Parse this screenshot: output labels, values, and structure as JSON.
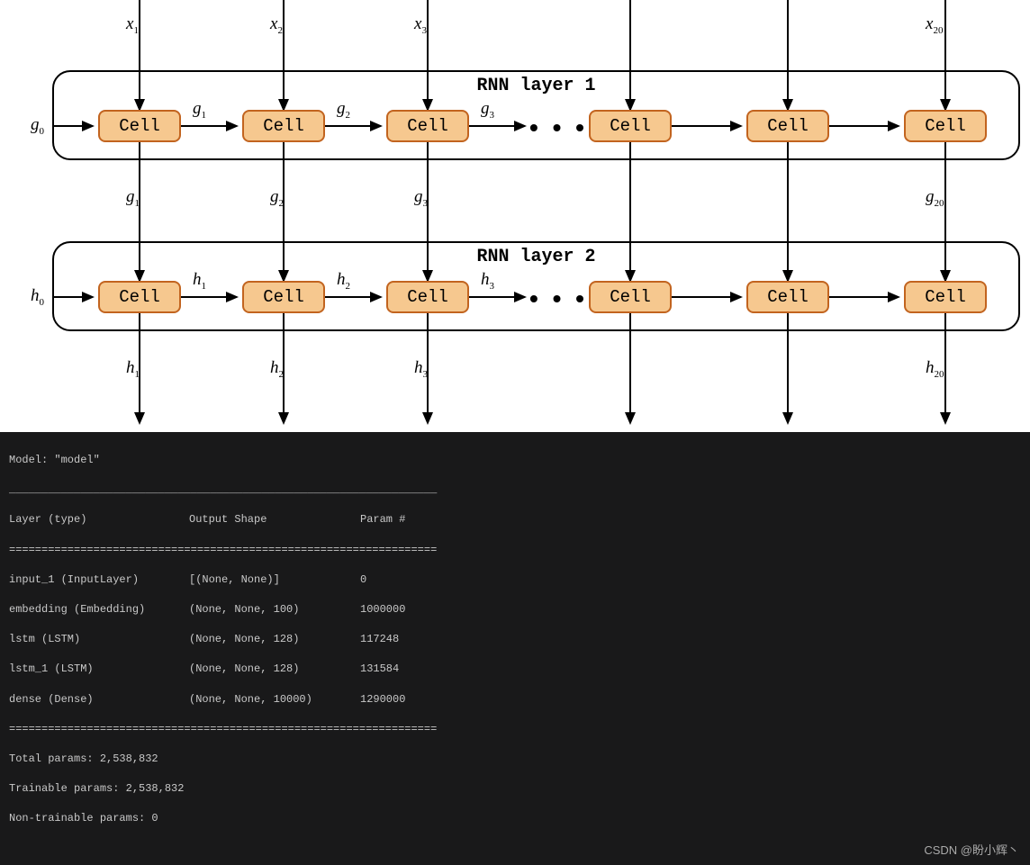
{
  "diagram": {
    "layer1": {
      "title": "RNN layer 1"
    },
    "layer2": {
      "title": "RNN layer 2"
    },
    "cell_label": "Cell",
    "inputs": {
      "x1": "x",
      "x1s": "1",
      "x2": "x",
      "x2s": "2",
      "x3": "x",
      "x3s": "3",
      "x20": "x",
      "x20s": "20"
    },
    "g_init": "g",
    "g_init_s": "0",
    "g": {
      "g1": "g",
      "g1s": "1",
      "g2": "g",
      "g2s": "2",
      "g3": "g",
      "g3s": "3",
      "g20": "g",
      "g20s": "20"
    },
    "h_init": "h",
    "h_init_s": "0",
    "h": {
      "h1": "h",
      "h1s": "1",
      "h2": "h",
      "h2s": "2",
      "h3": "h",
      "h3s": "3",
      "h20": "h",
      "h20s": "20"
    },
    "dots": "• • •"
  },
  "terminal": {
    "model_name": "Model: \"model\"",
    "header_layer": "Layer (type)",
    "header_shape": "Output Shape",
    "header_param": "Param #",
    "rows": [
      {
        "layer": "input_1 (InputLayer)",
        "shape": "[(None, None)]",
        "param": "0"
      },
      {
        "layer": "embedding (Embedding)",
        "shape": "(None, None, 100)",
        "param": "1000000"
      },
      {
        "layer": "lstm (LSTM)",
        "shape": "(None, None, 128)",
        "param": "117248"
      },
      {
        "layer": "lstm_1 (LSTM)",
        "shape": "(None, None, 128)",
        "param": "131584"
      },
      {
        "layer": "dense (Dense)",
        "shape": "(None, None, 10000)",
        "param": "1290000"
      }
    ],
    "divider": "==================================================================",
    "total": "Total params: 2,538,832",
    "trainable": "Trainable params: 2,538,832",
    "nontrainable": "Non-trainable params: 0"
  },
  "watermark": "CSDN @盼小辉丶"
}
